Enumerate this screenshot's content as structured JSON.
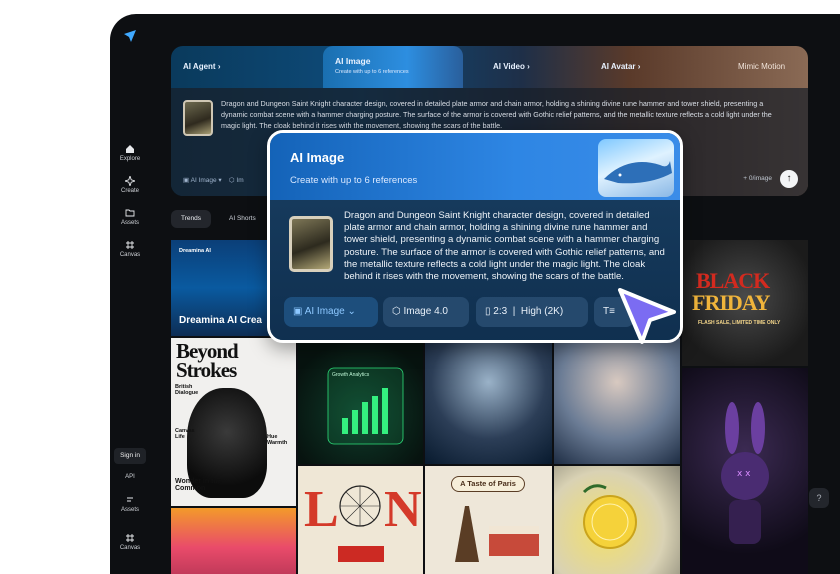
{
  "sidebar": {
    "items": [
      {
        "label": "Explore",
        "icon": "home-icon"
      },
      {
        "label": "Create",
        "icon": "sparkle-icon"
      },
      {
        "label": "Assets",
        "icon": "folder-icon"
      },
      {
        "label": "Canvas",
        "icon": "grid-icon"
      }
    ],
    "bottom": {
      "sign_in": "Sign in",
      "api": "API",
      "assets": "Assets",
      "canvas": "Canvas"
    }
  },
  "hero": {
    "tabs": [
      {
        "label": "AI Agent"
      },
      {
        "label": "AI Image",
        "sub": "Create with up to 6 references"
      },
      {
        "label": "AI Video"
      },
      {
        "label": "AI Avatar"
      },
      {
        "label": "Mimic Motion"
      }
    ],
    "prompt": "Dragon and Dungeon Saint Knight character design, covered in detailed plate armor and chain armor, holding a shining divine rune hammer and tower shield, presenting a dynamic combat scene with a hammer charging posture. The surface of the armor is covered with Gothic relief patterns, and the metallic texture reflects a cold light under the magic light. The cloak behind it rises with the movement, showing the scars of the battle.",
    "mode": "AI Image",
    "mode_short": "Im",
    "count": "+ 0/image",
    "send_icon": "arrow-up-icon"
  },
  "feed_tabs": [
    "Trends",
    "AI Shorts"
  ],
  "tiles": {
    "dreamina": {
      "brand": "Dreamina AI",
      "caption": "Dreamina AI Crea"
    },
    "beyond": {
      "title": "Beyond Strokes",
      "sub1": "British Dialogue",
      "sub2": "Hue Warmth",
      "sub3": "Canvas Life",
      "sub4": "Wonder in the Common"
    },
    "growth": {
      "label": "Growth Analytics"
    },
    "black_friday": {
      "line1": "BLACK",
      "line2": "FRIDAY",
      "line3": "FLASH SALE, LIMITED TIME ONLY"
    },
    "paris": {
      "title": "A Taste of Paris"
    }
  },
  "popup": {
    "title": "AI Image",
    "subtitle": "Create with up to 6 references",
    "prompt": "Dragon and Dungeon Saint Knight character design, covered in detailed plate armor and chain armor, holding a shining divine rune hammer and tower shield, presenting a dynamic combat scene with a hammer charging posture. The surface of the armor is covered with Gothic relief patterns, and the metallic texture reflects a cold light under the magic light. The cloak behind it rises with the movement, showing the scars of the battle.",
    "chips": {
      "mode": "AI Image",
      "model": "Image 4.0",
      "ratio": "2:3",
      "quality": "High (2K)"
    }
  },
  "help_icon": "question-icon",
  "colors": {
    "accent": "#2e86e4",
    "frame": "#0d0f12"
  }
}
